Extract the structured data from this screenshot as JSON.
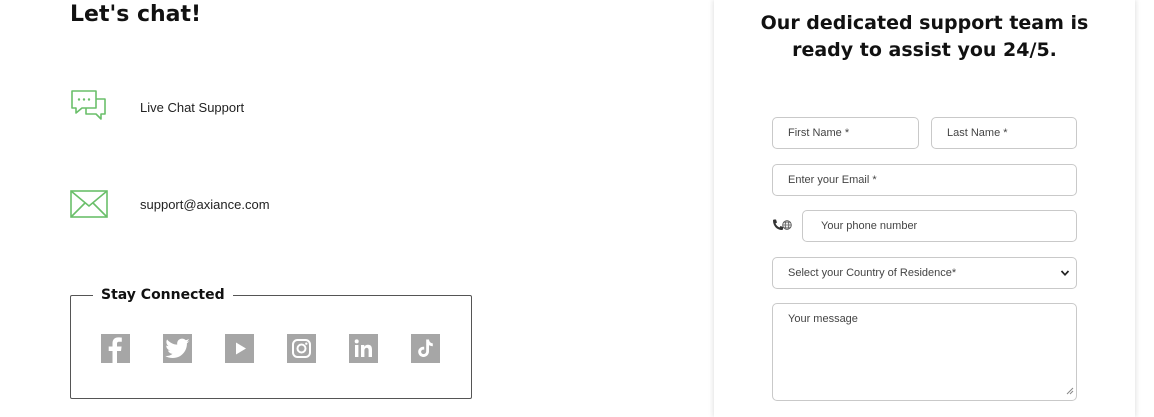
{
  "contact": {
    "title": "Let's chat!",
    "items": [
      {
        "icon": "chat-bubbles-icon",
        "label": "Live Chat Support"
      },
      {
        "icon": "envelope-icon",
        "label": "support@axiance.com"
      }
    ],
    "stay_connected": {
      "title": "Stay Connected",
      "networks": [
        {
          "icon": "facebook-icon"
        },
        {
          "icon": "twitter-icon"
        },
        {
          "icon": "youtube-icon"
        },
        {
          "icon": "instagram-icon"
        },
        {
          "icon": "linkedin-icon"
        },
        {
          "icon": "tiktok-icon"
        }
      ]
    }
  },
  "form": {
    "title_line1": "Our dedicated support team is",
    "title_line2": "ready to assist you 24/5.",
    "first_name_placeholder": "First Name *",
    "last_name_placeholder": "Last Name *",
    "email_placeholder": "Enter your Email *",
    "phone_placeholder": "Your phone number",
    "country_placeholder": "Select your Country of Residence*",
    "message_placeholder": "Your message"
  },
  "colors": {
    "accent_green": "#6abf6a",
    "social_grey": "#a6a6a6"
  }
}
